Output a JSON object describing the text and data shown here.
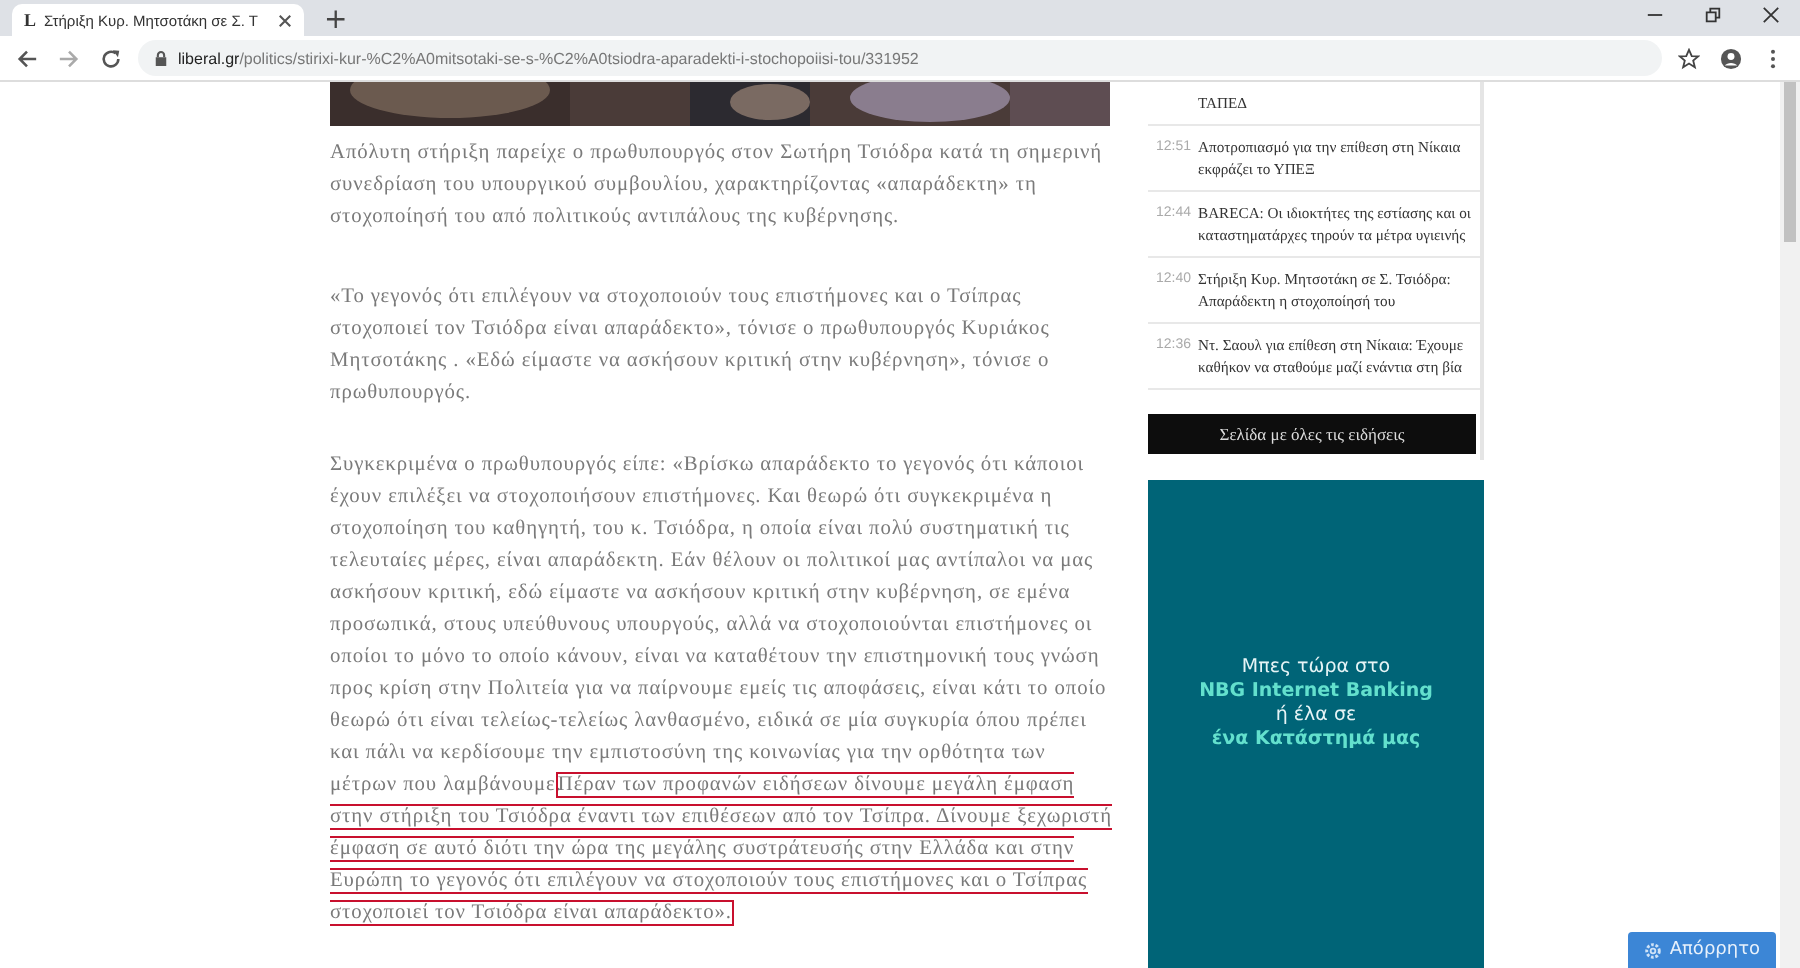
{
  "browser": {
    "tab": {
      "favicon": "L",
      "title": "Στήριξη Κυρ. Μητσοτάκη σε Σ. Τ"
    },
    "new_tab": "+",
    "url": {
      "domain": "liberal.gr",
      "path": "/politics/stirixi-kur-%C2%A0mitsotaki-se-s-%C2%A0tsiodra-aparadekti-i-stochopoiisi-tou/331952"
    }
  },
  "article": {
    "paragraphs": [
      {
        "text": "Απόλυτη στήριξη παρείχε ο πρωθυπουργός στον Σωτήρη Τσιόδρα κατά τη σημερινή συνεδρίαση του υπουργικού συμβουλίου, χαρακτηρίζοντας «απαράδεκτη» τη στοχοποίησή του από πολιτικούς αντιπάλους της κυβέρνησης."
      },
      {
        "text": "«Το γεγονός ότι επιλέγουν να στοχοποιούν τους επιστήμονες και ο Τσίπρας στοχοποιεί τον Τσιόδρα είναι απαράδεκτο», τόνισε ο πρωθυπουργός Κυριάκος Μητσοτάκης . «Εδώ είμαστε να ασκήσουν κριτική στην κυβέρνηση», τόνισε ο πρωθυπουργός."
      },
      {
        "text": "Συγκεκριμένα ο πρωθυπουργός είπε: «Βρίσκω απαράδεκτο το γεγονός ότι κάποιοι έχουν επιλέξει να στοχοποιήσουν επιστήμονες. Και θεωρώ ότι συγκεκριμένα η στοχοποίηση του καθηγητή, του κ. Τσιόδρα, η οποία είναι πολύ συστηματική τις τελευταίες μέρες, είναι απαράδεκτη. Εάν θέλουν οι πολιτικοί μας αντίπαλοι να μας ασκήσουν κριτική, εδώ είμαστε να ασκήσουν κριτική στην κυβέρνηση, σε εμένα προσωπικά, στους υπεύθυνους υπουργούς, αλλά να στοχοποιούνται επιστήμονες οι οποίοι το μόνο το οποίο κάνουν, είναι να καταθέτουν την επιστημονική τους γνώση προς κρίση στην Πολιτεία για να παίρνουμε εμείς τις αποφάσεις, είναι κάτι το οποίο θεωρώ ότι είναι τελείως-τελείως λανθασμένο, ειδικά σε μία συγκυρία όπου πρέπει και πάλι να κερδίσουμε την εμπιστοσύνη της κοινωνίας για την ορθότητα των μέτρων που λαμβάνουμε.",
        "highlight": "Πέραν των προφανών ειδήσεων δίνουμε μεγάλη έμφαση στην στήριξη του Τσιόδρα έναντι των επιθέσεων από τον Τσίπρα.  Δίνουμε ξεχωριστή έμφαση σε αυτό διότι την ώρα της μεγάλης συστράτευσής στην Ελλάδα και στην Ευρώπη το γεγονός ότι επιλέγουν να στοχοποιούν τους επιστήμονες και ο Τσίπρας στοχοποιεί τον Τσιόδρα είναι απαράδεκτο»."
      }
    ]
  },
  "news": {
    "items": [
      {
        "title": "ΤΑΠΕΔ"
      },
      {
        "time": "12:51",
        "title": "Αποτροπιασμό για την επίθεση στη Νίκαια εκφράζει το ΥΠΕΞ"
      },
      {
        "time": "12:44",
        "title": "BARECA: Οι ιδιοκτήτες της εστίασης και οι καταστηματάρχες τηρούν τα μέτρα υγιεινής"
      },
      {
        "time": "12:40",
        "title": "Στήριξη Κυρ. Μητσοτάκη σε Σ. Τσιόδρα: Απαράδεκτη η στοχοποίησή του"
      },
      {
        "time": "12:36",
        "title": "Ντ. Σαουλ για επίθεση στη Νίκαια: Έχουμε καθήκον να σταθούμε μαζί ενάντια στη βία"
      }
    ],
    "all_button": "Σελίδα με όλες τις ειδήσεις"
  },
  "ad": {
    "lines": [
      {
        "text": "Μπες τώρα στο",
        "emphasis": false
      },
      {
        "text": "NBG Internet Banking",
        "emphasis": true
      },
      {
        "text": "ή έλα σε",
        "emphasis": false
      },
      {
        "text": "ένα Κατάστημά μας",
        "emphasis": true
      }
    ]
  },
  "privacy_button": "Απόρρητο"
}
